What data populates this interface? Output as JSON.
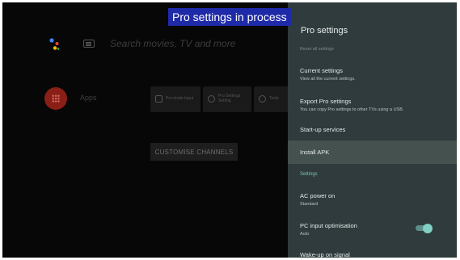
{
  "banner": "Pro settings in process",
  "home": {
    "search_placeholder": "Search movies, TV and more",
    "apps_label": "Apps",
    "tiles": [
      "Pro mode Input",
      "Pro Settings Setting",
      "Tools"
    ],
    "customise_button": "CUSTOMISE CHANNELS"
  },
  "panel": {
    "title": "Pro settings",
    "reset_sub": "Reset all settings",
    "items": [
      {
        "label": "Current settings",
        "sub": "View all the current settings."
      },
      {
        "label": "Export Pro settings",
        "sub": "You can copy Pro settings to other TVs using a USB."
      },
      {
        "label": "Start-up services"
      },
      {
        "label": "Install APK"
      },
      {
        "label": "AC power on",
        "sub": "Standard"
      },
      {
        "label": "PC input optimisation",
        "sub": "Auto"
      },
      {
        "label": "Wake-up on signal"
      }
    ],
    "section_header": "Settings",
    "toggle_on": true
  },
  "colors": {
    "banner_bg": "#1f2aa8",
    "panel_bg": "#2f3b3c",
    "highlight": "#45514f",
    "accent": "#7fd1c4"
  }
}
